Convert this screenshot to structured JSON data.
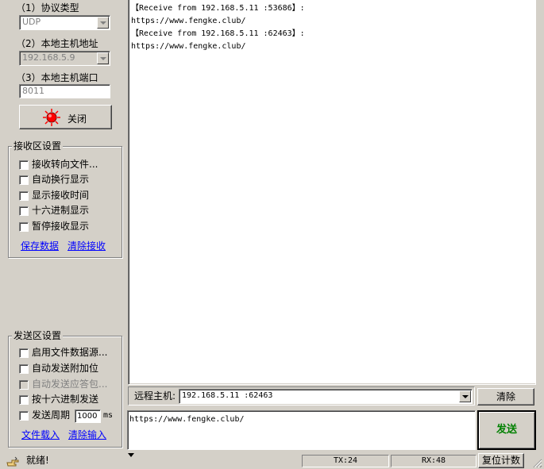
{
  "connection": {
    "protocol_label": "（1）协议类型",
    "protocol_value": "UDP",
    "local_addr_label": "（2）本地主机地址",
    "local_addr_value": "192.168.5.9",
    "local_port_label": "（3）本地主机端口",
    "local_port_value": "8011",
    "toggle_button_label": "关闭",
    "indicator_color": "#ff0000"
  },
  "receive_settings": {
    "title": "接收区设置",
    "options": [
      {
        "label": "接收转向文件...",
        "checked": false
      },
      {
        "label": "自动换行显示",
        "checked": false
      },
      {
        "label": "显示接收时间",
        "checked": false
      },
      {
        "label": "十六进制显示",
        "checked": false
      },
      {
        "label": "暂停接收显示",
        "checked": false
      }
    ],
    "save_link": "保存数据",
    "clear_link": "清除接收"
  },
  "send_settings": {
    "title": "发送区设置",
    "options": [
      {
        "label": "启用文件数据源...",
        "checked": false,
        "disabled": false
      },
      {
        "label": "自动发送附加位",
        "checked": false,
        "disabled": false
      },
      {
        "label": "自动发送应答包...",
        "checked": false,
        "disabled": true
      },
      {
        "label": "按十六进制发送",
        "checked": false,
        "disabled": false
      },
      {
        "label": "发送周期",
        "checked": false,
        "disabled": false
      }
    ],
    "period_value": "1000",
    "period_unit": "ms",
    "load_file_link": "文件载入",
    "clear_input_link": "清除输入"
  },
  "receive_area": {
    "lines": [
      "【Receive from 192.168.5.11 :53686】:",
      "https://www.fengke.club/",
      "【Receive from 192.168.5.11 :62463】:",
      "https://www.fengke.club/"
    ]
  },
  "remote": {
    "label": "远程主机:",
    "value": "192.168.5.11 :62463",
    "clear_button": "清除"
  },
  "send_area": {
    "text": "https://www.fengke.club/",
    "send_button": "发送",
    "send_color": "#008000"
  },
  "status_bar": {
    "status_text": "就绪!",
    "tx": "TX:24",
    "rx": "RX:48",
    "reset_button": "复位计数"
  }
}
